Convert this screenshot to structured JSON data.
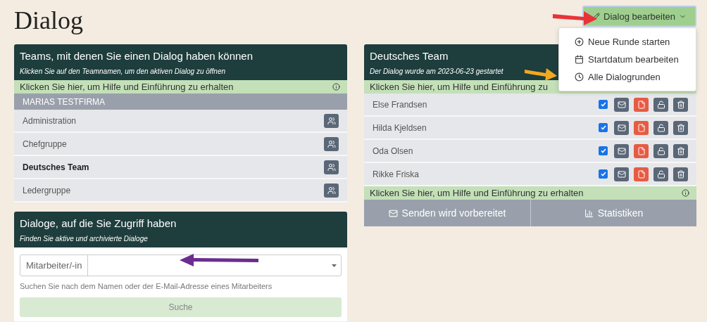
{
  "title": "Dialog",
  "edit_menu": {
    "label": "Dialog bearbeiten",
    "expanded": true,
    "items": [
      {
        "kind": "plus",
        "label": "Neue Runde starten"
      },
      {
        "kind": "calendar",
        "label": "Startdatum bearbeiten"
      },
      {
        "kind": "clock",
        "label": "Alle Dialogrunden"
      }
    ]
  },
  "teams_panel": {
    "title": "Teams, mit denen Sie einen Dialog haben können",
    "subtitle": "Klicken Sie auf den Teamnamen, um den aktiven Dialog zu öffnen",
    "help": "Klicken Sie hier, um Hilfe und Einführung zu erhalten",
    "group": "MARIAS TESTFIRMA",
    "teams": [
      {
        "name": "Administration",
        "selected": false
      },
      {
        "name": "Chefgruppe",
        "selected": false
      },
      {
        "name": "Deutsches Team",
        "selected": true
      },
      {
        "name": "Ledergruppe",
        "selected": false
      }
    ]
  },
  "search_panel": {
    "title": "Dialoge, auf die Sie Zugriff haben",
    "subtitle": "Finden Sie aktive und archivierte Dialoge",
    "field_label": "Mitarbeiter/-in",
    "hint": "Suchen Sie nach dem Namen oder der E-Mail-Adresse eines Mitarbeiters",
    "button": "Suche"
  },
  "team_panel": {
    "title": "Deutsches Team",
    "subtitle": "Der Dialog wurde am 2023-06-23 gestartet",
    "help_top": "Klicken Sie hier, um Hilfe und Einführung zu",
    "members": [
      {
        "name": "Else Frandsen",
        "checked": true
      },
      {
        "name": "Hilda Kjeldsen",
        "checked": true
      },
      {
        "name": "Oda Olsen",
        "checked": true
      },
      {
        "name": "Rikke Friska",
        "checked": true
      }
    ],
    "help_bottom": "Klicken Sie hier, um Hilfe und Einführung zu erhalten",
    "actions": [
      {
        "kind": "mail",
        "label": "Senden wird vorbereitet"
      },
      {
        "kind": "chart",
        "label": "Statistiken"
      }
    ]
  }
}
